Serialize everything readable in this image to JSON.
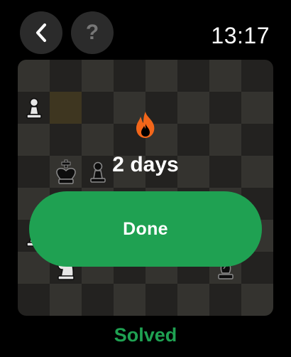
{
  "header": {
    "back_icon": "chevron-left-icon",
    "help_label": "?",
    "time": "13:17"
  },
  "board": {
    "pieces": [
      {
        "square": "a7",
        "type": "pawn",
        "color": "white"
      },
      {
        "square": "b5",
        "type": "king",
        "color": "black"
      },
      {
        "square": "c5",
        "type": "pawn",
        "color": "black"
      },
      {
        "square": "a3",
        "type": "pawn",
        "color": "white"
      },
      {
        "square": "b2",
        "type": "knight",
        "color": "white"
      },
      {
        "square": "g2",
        "type": "bishop",
        "color": "black"
      }
    ],
    "highlighted_square": "b7"
  },
  "result": {
    "streak_icon": "flame-icon",
    "streak_text": "2 days",
    "done_label": "Done",
    "status_label": "Solved"
  },
  "colors": {
    "accent_green": "#1fa152",
    "flame_orange": "#f2661a"
  }
}
